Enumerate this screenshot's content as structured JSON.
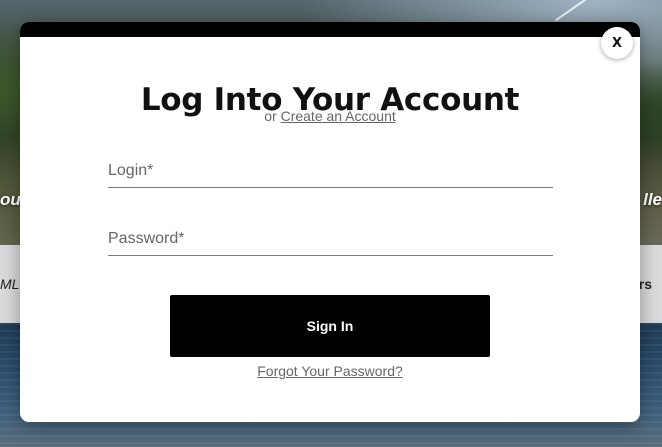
{
  "background": {
    "left_heading_fragment": "our",
    "right_heading_fragment": "lle",
    "band_left_fragment": "MLS",
    "band_right_fragment": "rs"
  },
  "modal": {
    "title": "Log Into Your Account",
    "subtitle_prefix": "or",
    "create_account_link": "Create an Account",
    "close_label": "X",
    "login_placeholder": "Login*",
    "login_value": "",
    "password_placeholder": "Password*",
    "password_value": "",
    "sign_in_label": "Sign In",
    "forgot_password_link": "Forgot Your Password?"
  },
  "colors": {
    "topbar": "#000000",
    "button_bg": "#000000",
    "button_text": "#ffffff",
    "link": "#666666",
    "band": "#d9dadb"
  }
}
